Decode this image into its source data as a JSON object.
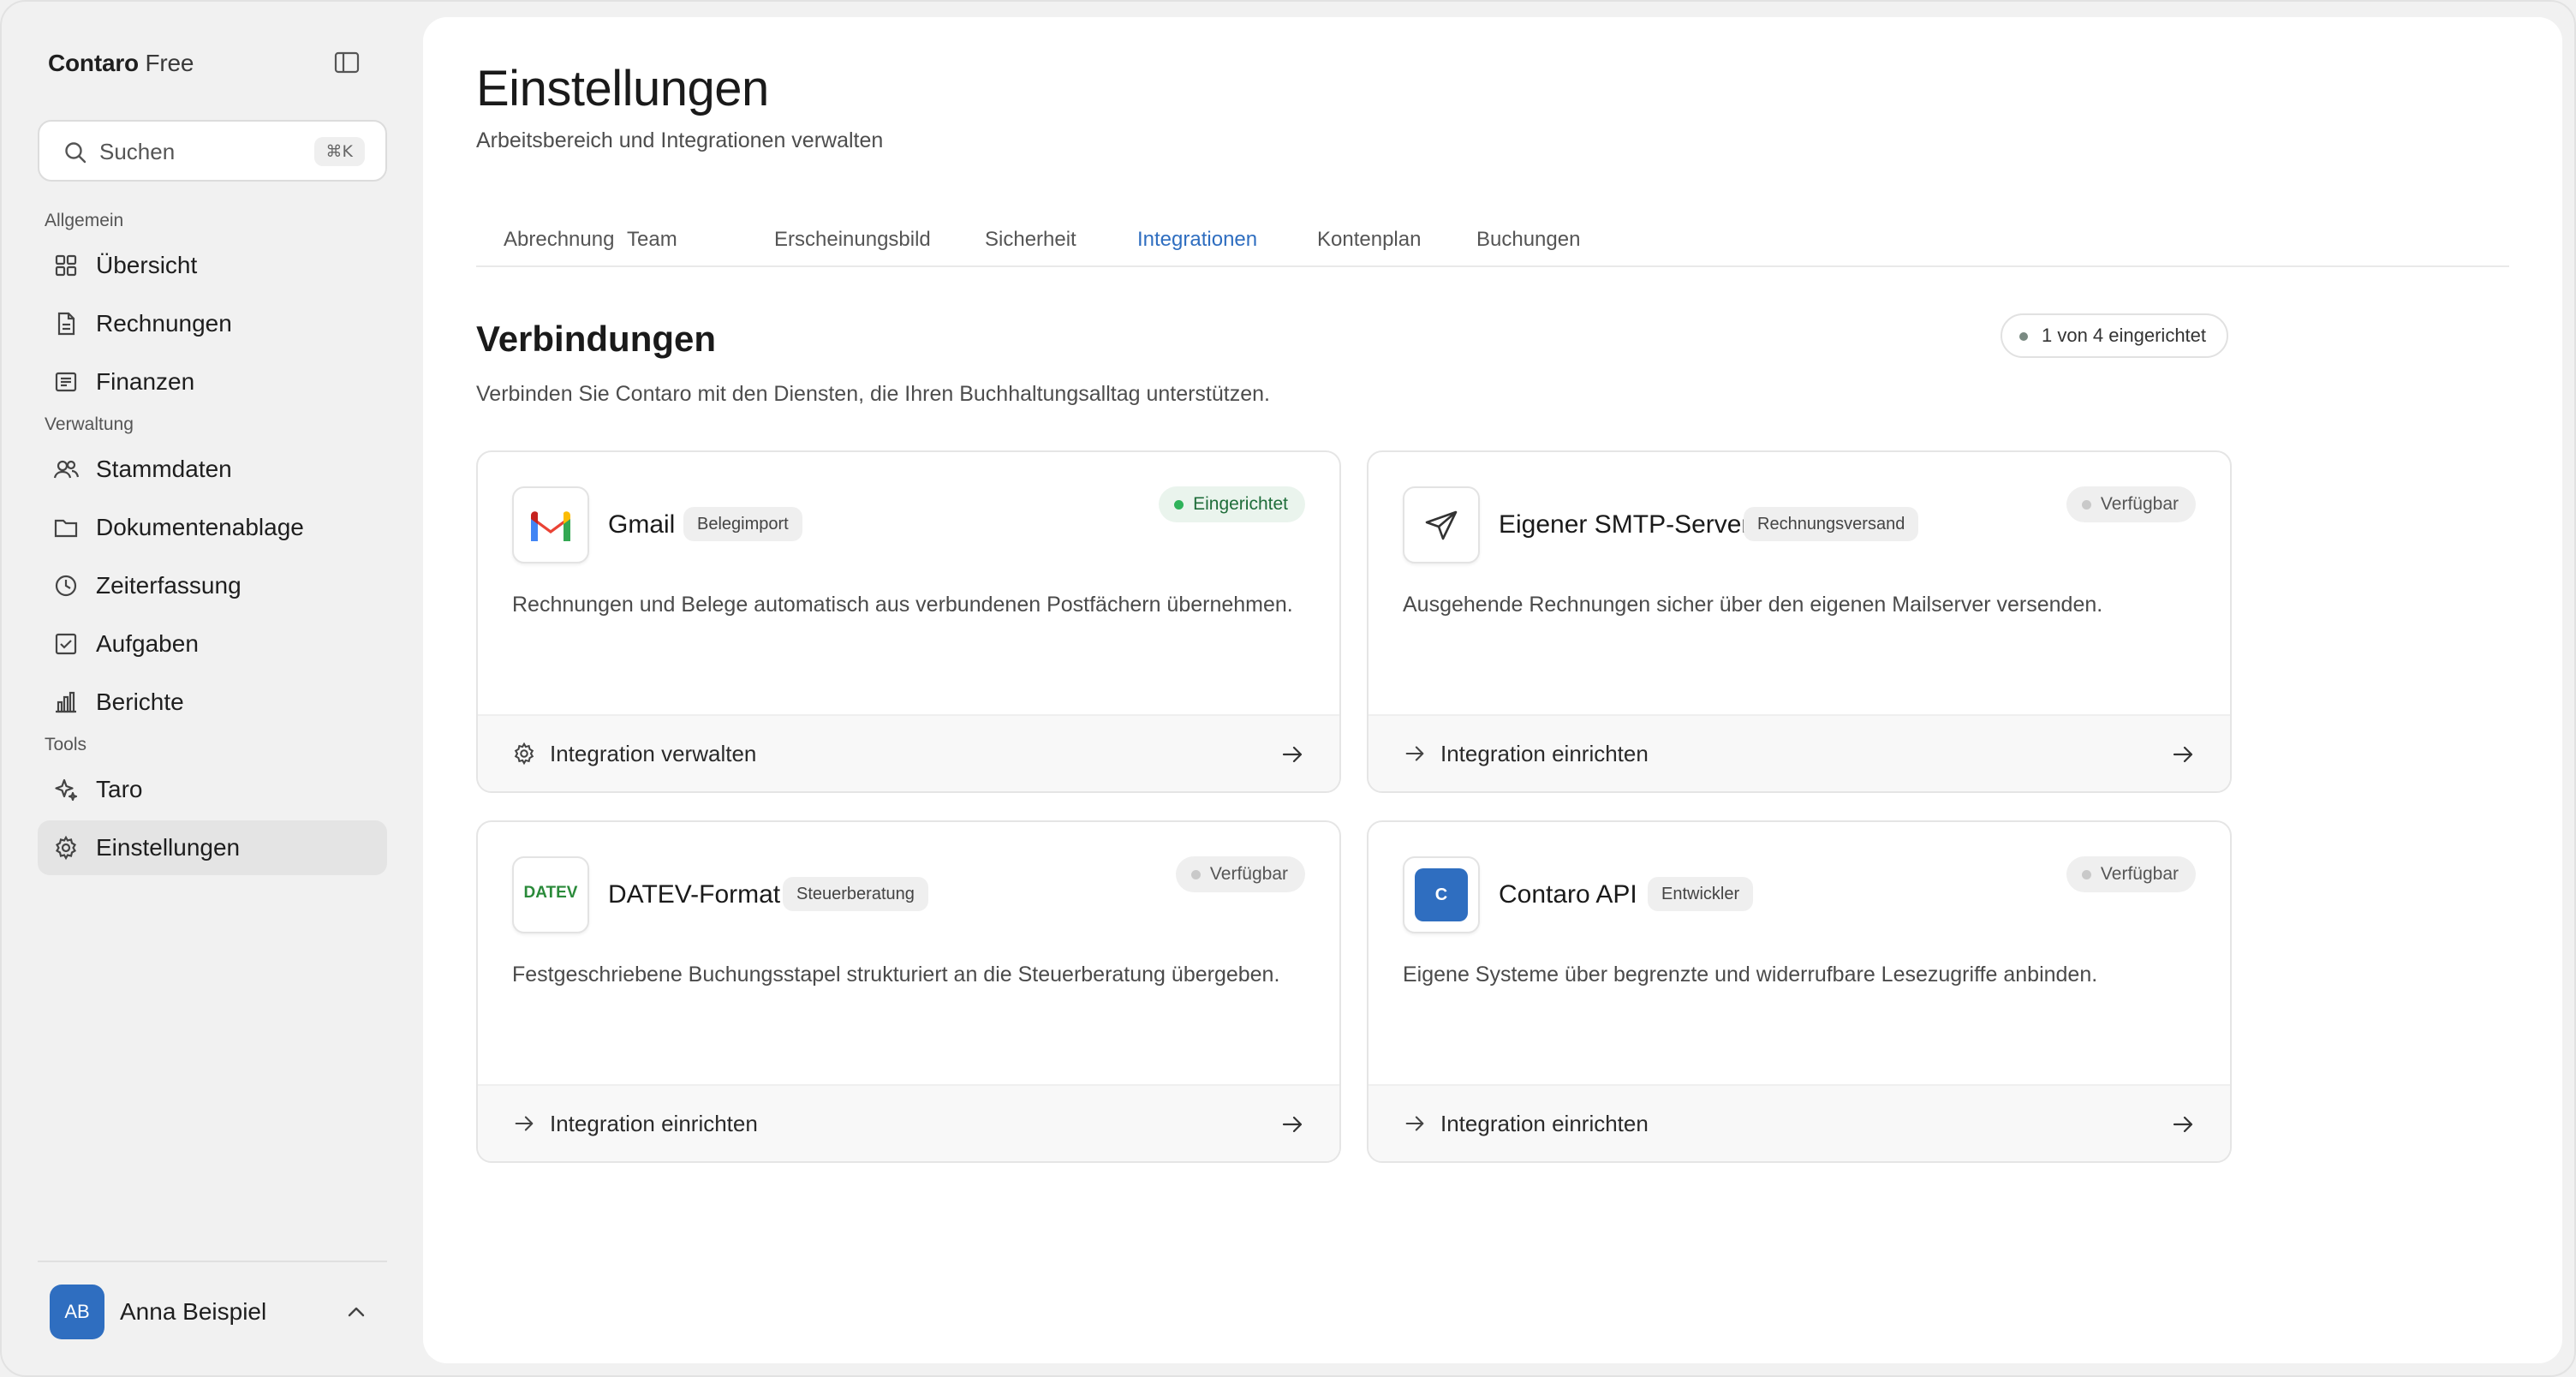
{
  "app": {
    "name": "Contaro",
    "plan": "Free"
  },
  "sidebar": {
    "search": {
      "placeholder": "Suchen",
      "shortcut": "⌘K"
    },
    "sections": [
      {
        "label": "Allgemein"
      },
      {
        "label": "Verwaltung"
      },
      {
        "label": "Tools"
      }
    ],
    "items": [
      {
        "label": "Übersicht",
        "icon": "grid-icon"
      },
      {
        "label": "Rechnungen",
        "icon": "document-icon"
      },
      {
        "label": "Finanzen",
        "icon": "receipt-icon"
      },
      {
        "label": "Stammdaten",
        "icon": "users-icon"
      },
      {
        "label": "Dokumentenablage",
        "icon": "folder-icon"
      },
      {
        "label": "Zeiterfassung",
        "icon": "clock-icon"
      },
      {
        "label": "Aufgaben",
        "icon": "checkbox-icon"
      },
      {
        "label": "Berichte",
        "icon": "bar-chart-icon"
      },
      {
        "label": "Taro",
        "icon": "sparkle-icon"
      },
      {
        "label": "Einstellungen",
        "icon": "gear-icon",
        "active": true
      }
    ],
    "user": {
      "initials": "AB",
      "name": "Anna Beispiel"
    }
  },
  "header": {
    "title": "Einstellungen",
    "subtitle": "Arbeitsbereich und Integrationen verwalten"
  },
  "tabs": [
    {
      "label": "Abrechnung"
    },
    {
      "label": "Team"
    },
    {
      "label": "Erscheinungsbild"
    },
    {
      "label": "Sicherheit"
    },
    {
      "label": "Integrationen",
      "active": true
    },
    {
      "label": "Kontenplan"
    },
    {
      "label": "Buchungen"
    }
  ],
  "connections": {
    "title": "Verbindungen",
    "description": "Verbinden Sie Contaro mit den Diensten, die Ihren Buchhaltungsalltag unterstützen.",
    "counter": "1 von 4 eingerichtet",
    "cards": [
      {
        "name": "Gmail",
        "tag": "Belegimport",
        "status": "Eingerichtet",
        "status_type": "connected",
        "description": "Rechnungen und Belege automatisch aus verbundenen Postfächern übernehmen.",
        "action": "Integration verwalten",
        "logo": "gmail-logo"
      },
      {
        "name": "Eigener SMTP-Server",
        "tag": "Rechnungsversand",
        "status": "Verfügbar",
        "status_type": "available",
        "description": "Ausgehende Rechnungen sicher über den eigenen Mailserver versenden.",
        "action": "Integration einrichten",
        "logo": "paper-plane-icon"
      },
      {
        "name": "DATEV-Format",
        "tag": "Steuerberatung",
        "status": "Verfügbar",
        "status_type": "available",
        "description": "Festgeschriebene Buchungsstapel strukturiert an die Steuerberatung übergeben.",
        "action": "Integration einrichten",
        "logo": "datev-logo",
        "logo_text": "DATEV"
      },
      {
        "name": "Contaro API",
        "tag": "Entwickler",
        "status": "Verfügbar",
        "status_type": "available",
        "description": "Eigene Systeme über begrenzte und widerrufbare Lesezugriffe anbinden.",
        "action": "Integration einrichten",
        "logo": "contaro-api-logo",
        "logo_text": "C"
      }
    ]
  },
  "colors": {
    "accent": "#2f6ec0",
    "status_connected": "#2fb35a",
    "status_available": "#c9c9c9",
    "background": "#f1f1f1",
    "surface": "#ffffff"
  }
}
